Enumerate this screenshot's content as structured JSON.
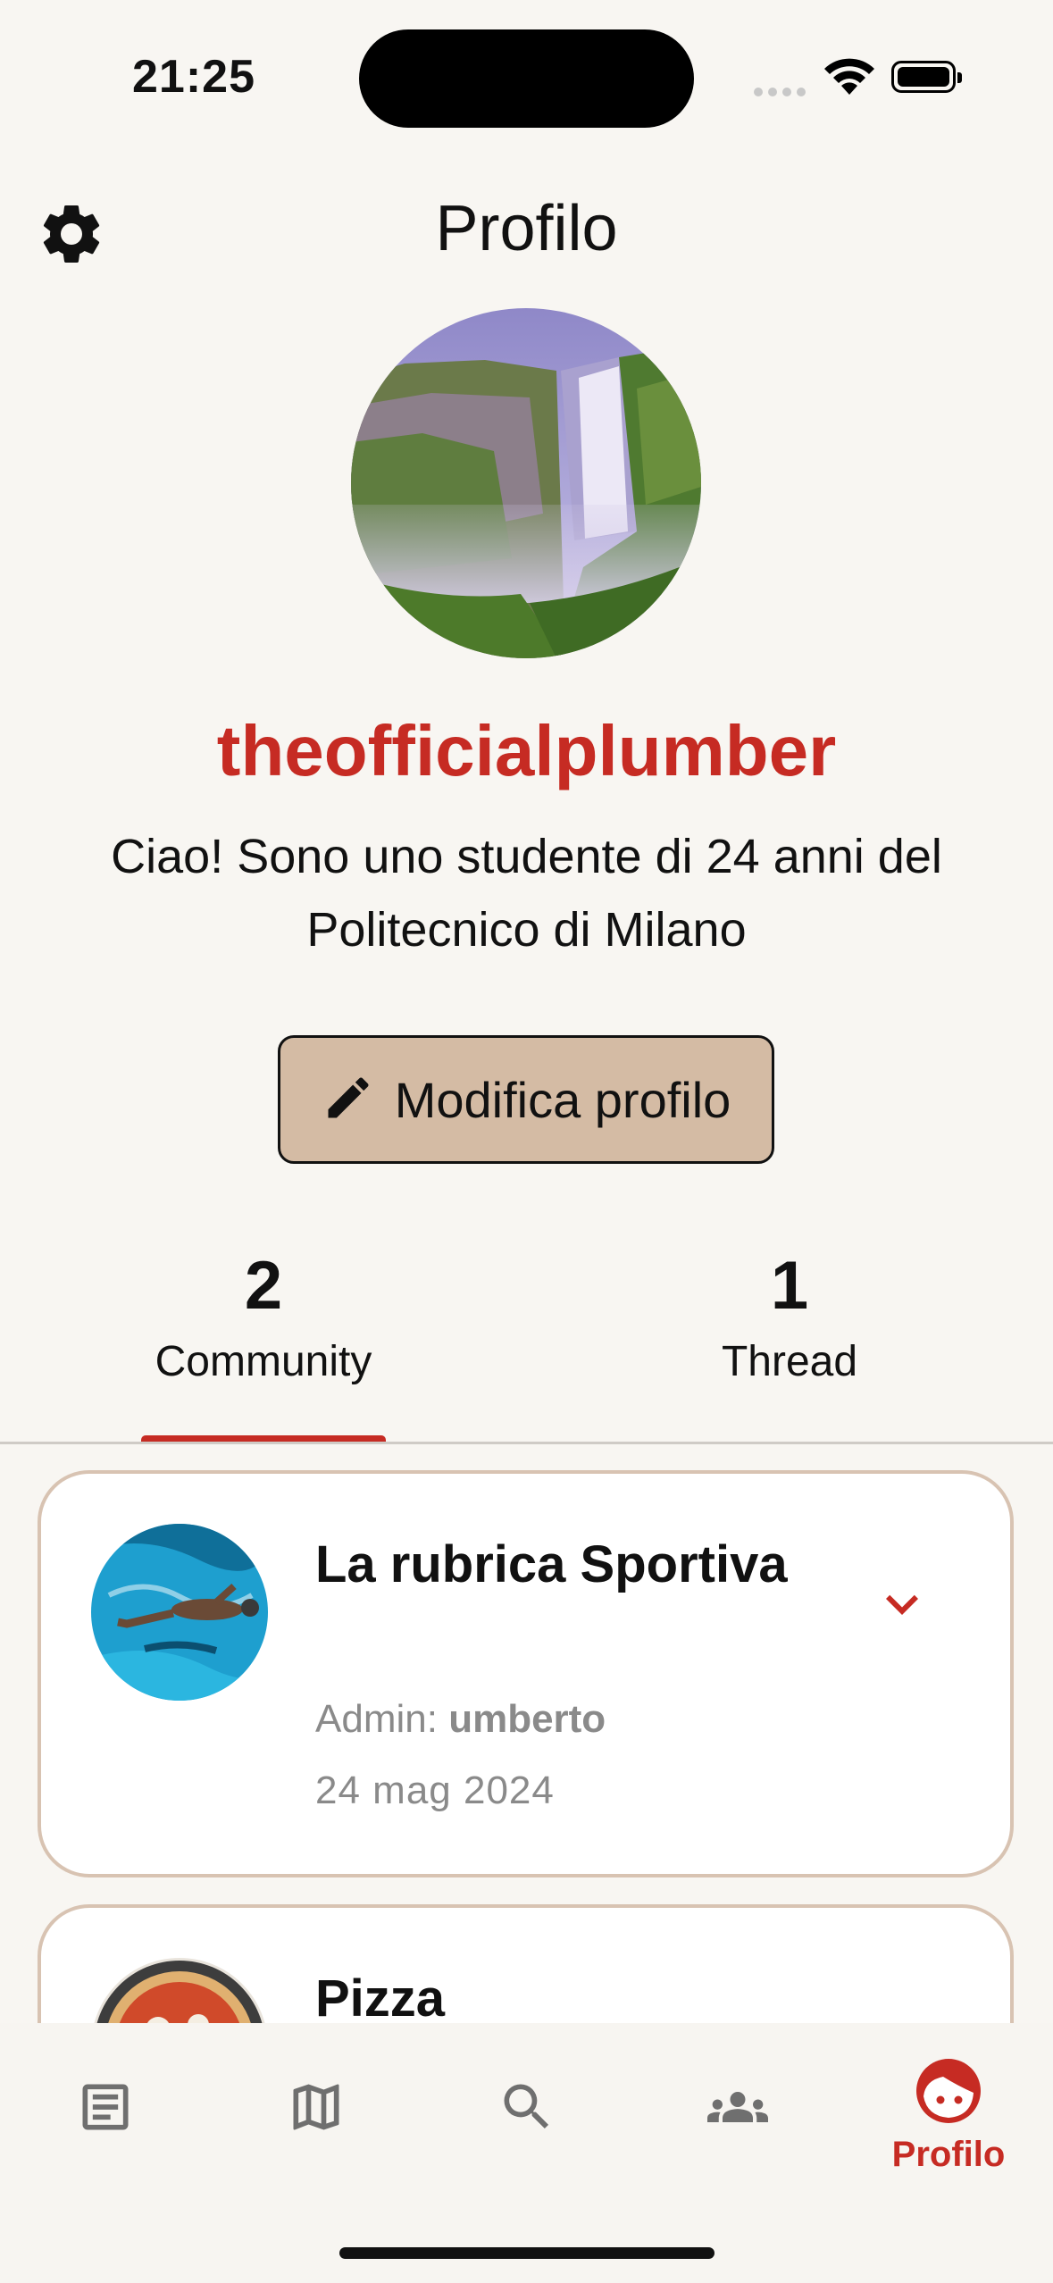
{
  "status_bar": {
    "time": "21:25"
  },
  "header": {
    "title": "Profilo"
  },
  "profile": {
    "username": "theofficialplumber",
    "bio": "Ciao! Sono uno studente di 24 anni del Politecnico di Milano",
    "edit_label": "Modifica profilo"
  },
  "tabs": [
    {
      "count": "2",
      "label": "Community",
      "active": true
    },
    {
      "count": "1",
      "label": "Thread",
      "active": false
    }
  ],
  "communities": [
    {
      "title": "La rubrica Sportiva",
      "admin_prefix": "Admin:",
      "admin": "umberto",
      "date": "24 mag 2024"
    },
    {
      "title": "Pizza"
    }
  ],
  "bottom_nav": {
    "items": [
      {
        "icon": "article-icon"
      },
      {
        "icon": "map-icon"
      },
      {
        "icon": "search-icon"
      },
      {
        "icon": "group-icon"
      },
      {
        "icon": "profile-face-icon",
        "label": "Profilo",
        "active": true
      }
    ]
  },
  "colors": {
    "accent": "#c62b23",
    "background": "#f8f6f2",
    "button": "#d4bba4",
    "card_border": "#d8c3b2"
  }
}
